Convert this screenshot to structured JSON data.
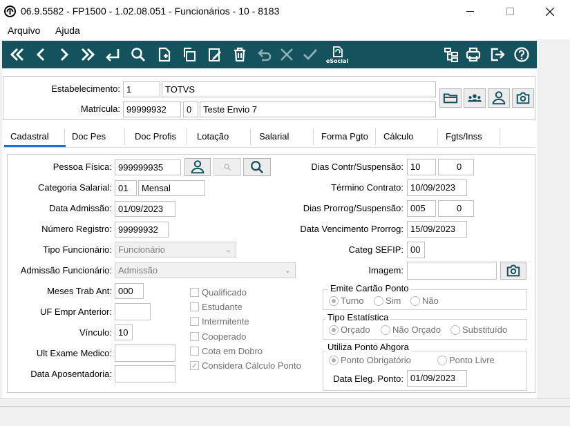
{
  "window": {
    "title": "06.9.5582 - FP1500 - 1.02.08.051 - Funcionários - 10 - 8183",
    "minimize": "—",
    "maximize": "☐",
    "close": "✕"
  },
  "menu": {
    "items": [
      "Arquivo",
      "Ajuda"
    ]
  },
  "toolbar": {
    "icons": [
      "first-icon",
      "prev-icon",
      "next-icon",
      "last-icon",
      "enter-icon",
      "search-icon",
      "new-icon",
      "copy-icon",
      "edit-icon",
      "delete-icon",
      "undo-icon",
      "cancel-icon",
      "confirm-icon",
      "esocial-icon",
      "tree-icon",
      "print-icon",
      "exit-icon",
      "help-icon"
    ],
    "esocial_label": "eSocial",
    "color": "#14525e"
  },
  "header": {
    "estabelecimento_label": "Estabelecimento:",
    "estabelecimento_code": "1",
    "estabelecimento_name": "TOTVS",
    "matricula_label": "Matrícula:",
    "matricula_value": "99999932",
    "matricula_digit": "0",
    "matricula_name": "Teste Envio 7",
    "buttons": [
      "folder-icon",
      "group-icon",
      "person-icon",
      "camera-icon"
    ]
  },
  "tabs": [
    "Cadastral",
    "Doc Pes",
    "Doc Profis",
    "Lotação",
    "Salarial",
    "Forma Pgto",
    "Cálculo",
    "Fgts/Inss"
  ],
  "active_tab": "Cadastral",
  "left_fields": {
    "pessoa_fisica_label": "Pessoa Física:",
    "pessoa_fisica_value": "999999935",
    "categoria_salarial_label": "Categoria Salarial:",
    "categoria_salarial_code": "01",
    "categoria_salarial_desc": "Mensal",
    "data_admissao_label": "Data Admissão:",
    "data_admissao_value": "01/09/2023",
    "numero_registro_label": "Número Registro:",
    "numero_registro_value": "99999932",
    "tipo_funcionario_label": "Tipo Funcionário:",
    "tipo_funcionario_value": "Funcionário",
    "admissao_funcionario_label": "Admissão Funcionário:",
    "admissao_funcionario_value": "Admissão",
    "meses_trab_ant_label": "Meses Trab Ant:",
    "meses_trab_ant_value": "000",
    "uf_empr_anterior_label": "UF Empr Anterior:",
    "uf_empr_anterior_value": "",
    "vinculo_label": "Vínculo:",
    "vinculo_value": "10",
    "ult_exame_label": "Ult Exame Medico:",
    "ult_exame_value": "",
    "data_aposentadoria_label": "Data Aposentadoria:",
    "data_aposentadoria_value": ""
  },
  "checkboxes": [
    {
      "label": "Qualificado",
      "checked": false
    },
    {
      "label": "Estudante",
      "checked": false
    },
    {
      "label": "Intermitente",
      "checked": false
    },
    {
      "label": "Cooperado",
      "checked": false
    },
    {
      "label": "Cota em Dobro",
      "checked": false
    },
    {
      "label": "Considera Cálculo Ponto",
      "checked": true
    }
  ],
  "right_fields": {
    "dias_contr_label": "Dias Contr/Suspensão:",
    "dias_contr_value1": "10",
    "dias_contr_value2": "0",
    "termino_contrato_label": "Término Contrato:",
    "termino_contrato_value": "10/09/2023",
    "dias_prorrog_label": "Dias Prorrog/Suspensão:",
    "dias_prorrog_value1": "005",
    "dias_prorrog_value2": "0",
    "data_venc_label": "Data Vencimento Prorrog:",
    "data_venc_value": "15/09/2023",
    "categ_sefip_label": "Categ SEFIP:",
    "categ_sefip_value": "00",
    "imagem_label": "Imagem:",
    "imagem_value": ""
  },
  "emite_cartao": {
    "title": "Emite Cartão Ponto",
    "options": [
      "Turno",
      "Sim",
      "Não"
    ],
    "selected": "Turno"
  },
  "tipo_estatistica": {
    "title": "Tipo Estatística",
    "options": [
      "Orçado",
      "Não Orçado",
      "Substituído"
    ],
    "selected": "Orçado"
  },
  "ponto_ahgora": {
    "title": "Utiliza Ponto Ahgora",
    "options": [
      "Ponto Obrigatório",
      "Ponto Livre"
    ],
    "selected": "Ponto Obrigatório",
    "data_eleg_label": "Data Eleg. Ponto:",
    "data_eleg_value": "01/09/2023"
  }
}
